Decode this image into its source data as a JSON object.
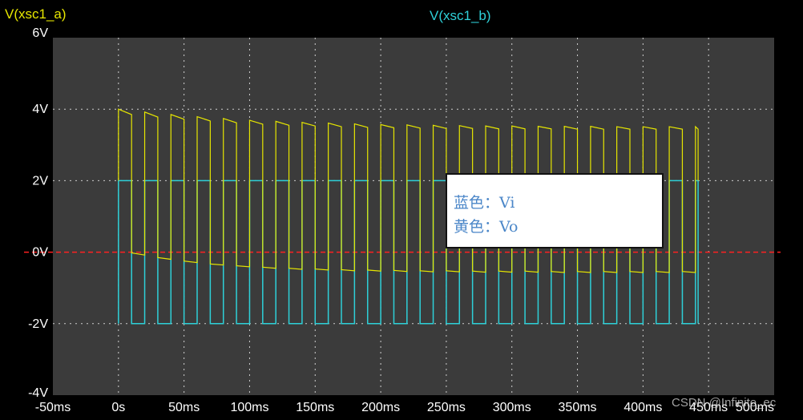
{
  "channels": {
    "a_label": "V(xsc1_a)",
    "b_label": "V(xsc1_b)",
    "a_color": "#e6e600",
    "b_color": "#2ed0d8",
    "zero_line_color": "#ff2020"
  },
  "legend": {
    "line1": "蓝色：Vi",
    "line2": "黄色：Vo"
  },
  "watermark": "CSDN @Infinite_ec",
  "chart_data": {
    "type": "line",
    "title": "",
    "xlabel": "",
    "ylabel": "",
    "xlim": [
      -50,
      500
    ],
    "ylim": [
      -4,
      6
    ],
    "grid": true,
    "x_ticks": [
      -50,
      0,
      50,
      100,
      150,
      200,
      250,
      300,
      350,
      400,
      450,
      500
    ],
    "x_tick_labels": [
      "-50ms",
      "0s",
      "50ms",
      "100ms",
      "150ms",
      "200ms",
      "250ms",
      "300ms",
      "350ms",
      "400ms",
      "450ms",
      "500ms"
    ],
    "y_ticks": [
      -4,
      -2,
      0,
      2,
      4,
      6
    ],
    "y_tick_labels": [
      "-4V",
      "-2V",
      "0V",
      "2V",
      "4V",
      "6V"
    ],
    "square_wave": {
      "name": "Vi",
      "high": 2,
      "low": -2,
      "start": 0,
      "end": 442,
      "high_duration": 10,
      "low_duration": 10
    },
    "output_wave": {
      "name": "Vo",
      "start": 0,
      "end": 442,
      "period": 20,
      "high_duration": 10,
      "high_segment_start": [
        4.0,
        3.92,
        3.85,
        3.79,
        3.74,
        3.69,
        3.66,
        3.63,
        3.61,
        3.59,
        3.57,
        3.56,
        3.55,
        3.54,
        3.53,
        3.53,
        3.52,
        3.52,
        3.52,
        3.51,
        3.51,
        3.51,
        3.51
      ],
      "high_segment_end": [
        3.85,
        3.78,
        3.72,
        3.67,
        3.62,
        3.58,
        3.55,
        3.53,
        3.51,
        3.49,
        3.48,
        3.47,
        3.46,
        3.46,
        3.45,
        3.45,
        3.45,
        3.44,
        3.44,
        3.44,
        3.44,
        3.44,
        3.44
      ],
      "low_segment_start": [
        -0.02,
        -0.15,
        -0.25,
        -0.33,
        -0.38,
        -0.42,
        -0.45,
        -0.47,
        -0.49,
        -0.5,
        -0.51,
        -0.52,
        -0.52,
        -0.53,
        -0.53,
        -0.53,
        -0.54,
        -0.54,
        -0.54,
        -0.54,
        -0.54,
        -0.54
      ],
      "low_segment_end": [
        -0.08,
        -0.2,
        -0.29,
        -0.36,
        -0.41,
        -0.45,
        -0.48,
        -0.5,
        -0.52,
        -0.53,
        -0.54,
        -0.55,
        -0.55,
        -0.56,
        -0.56,
        -0.56,
        -0.57,
        -0.57,
        -0.57,
        -0.57,
        -0.57,
        -0.57
      ]
    }
  }
}
